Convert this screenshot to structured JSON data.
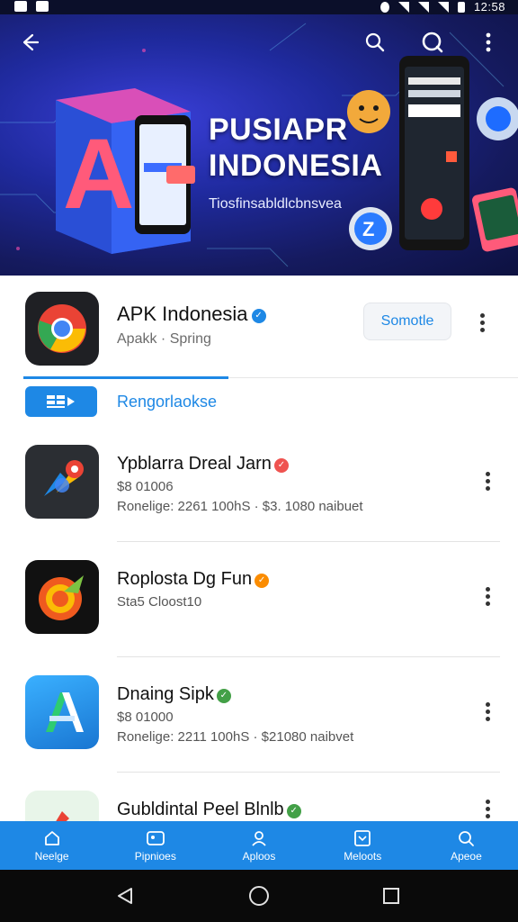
{
  "status_bar": {
    "time": "12:58"
  },
  "hero": {
    "title_line1": "PUSIAPR",
    "title_line2": "INDONESIA",
    "subtitle": "Tiosfinsabldlcbnsvea"
  },
  "app": {
    "name": "APK Indonesia",
    "meta": "Apakk · Spring",
    "action_label": "Somotle"
  },
  "tab": {
    "label": "Rengorlaokse"
  },
  "items": [
    {
      "title": "Ypblarra Dreal Jarn",
      "line1": "$8 01006",
      "line2": "Ronelige: 2261 100hS · $3. 1080 naibuet",
      "badge_color": "#ef5350"
    },
    {
      "title": "Roplosta Dg Fun",
      "line1": "Sta5 Cloost10",
      "line2": "",
      "badge_color": "#fb8c00"
    },
    {
      "title": "Dnaing Sipk",
      "line1": "$8 01000",
      "line2": "Ronelige: 2211 100hS · $21080 naibvet",
      "badge_color": "#43a047"
    },
    {
      "title": "Gubldintal Peel Blnlb",
      "line1": "",
      "line2": "",
      "badge_color": "#43a047"
    }
  ],
  "bottom_nav": [
    {
      "label": "Neelge",
      "icon": "home-icon"
    },
    {
      "label": "Pipnioes",
      "icon": "gallery-icon"
    },
    {
      "label": "Aploos",
      "icon": "profile-icon"
    },
    {
      "label": "Meloots",
      "icon": "message-icon"
    },
    {
      "label": "Apeoe",
      "icon": "search-icon"
    }
  ],
  "colors": {
    "accent": "#1e88e5",
    "hero_dark": "#151a5e"
  }
}
